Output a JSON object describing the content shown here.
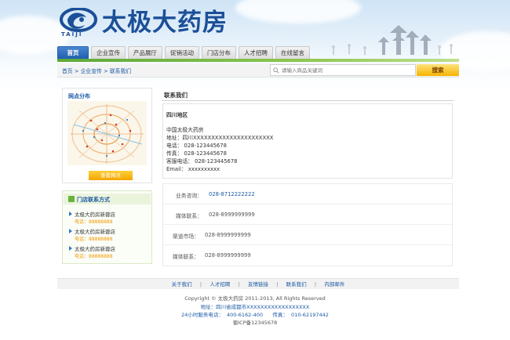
{
  "brand": {
    "name": "太极大药房",
    "logo_word": "TAIJI"
  },
  "nav": [
    "首页",
    "企业宣传",
    "产品展厅",
    "促销活动",
    "门店分布",
    "人才招聘",
    "在线留言"
  ],
  "breadcrumb": {
    "home": "首页",
    "sep": ">",
    "level1": "企业宣传",
    "level2": "联系我们"
  },
  "search": {
    "placeholder": "请输入商品关键词",
    "button": "搜索"
  },
  "sidebar": {
    "map_title": "网点分布",
    "map_button": "查看网点",
    "stores_title": "门店联系方式",
    "stores": [
      {
        "name": "太极大药房新蓉店",
        "tel": "电话：88888888"
      },
      {
        "name": "太极大药房新蓉店",
        "tel": "电话：88888888"
      },
      {
        "name": "太极大药房新蓉店",
        "tel": "电话：88888888"
      }
    ]
  },
  "main": {
    "title": "联系我们",
    "region": "四川地区",
    "company": "中国太极大药房",
    "address": "地址：四川XXXXXXXXXXXXXXXXXXXXXX",
    "phone": "电话： 028-123445678",
    "fax": "传真： 028-123445678",
    "service": "客服电话： 028-123445678",
    "email": "Email：  xxxxxxxxxx",
    "contacts": [
      {
        "label": "业务咨询：",
        "value": "028-8712222222"
      },
      {
        "label": "媒体联系：",
        "value": "028-8999999999"
      },
      {
        "label": "渠道市场：",
        "value": "028-8999999999"
      },
      {
        "label": "媒体联系：",
        "value": "028-8999999999"
      }
    ]
  },
  "footer": {
    "links": [
      "关于我们",
      "人才招聘",
      "友情链接",
      "联系我们",
      "内部邮件"
    ],
    "sep": "|",
    "copyright": "Copyright © 太极大药房 2011-2013, All Rights Reserved",
    "address": "地址：四川省成都市XXXXXXXXXXXXXXXXXX",
    "hotline": "24小时服务电话：  400-6162-400      传真：  010-62197442",
    "icp": "蜀ICP备12345678"
  },
  "colors": {
    "brand_blue": "#1b4f98",
    "link_blue": "#1b5aa6",
    "green": "#6bb23a",
    "orange": "#f39800"
  }
}
